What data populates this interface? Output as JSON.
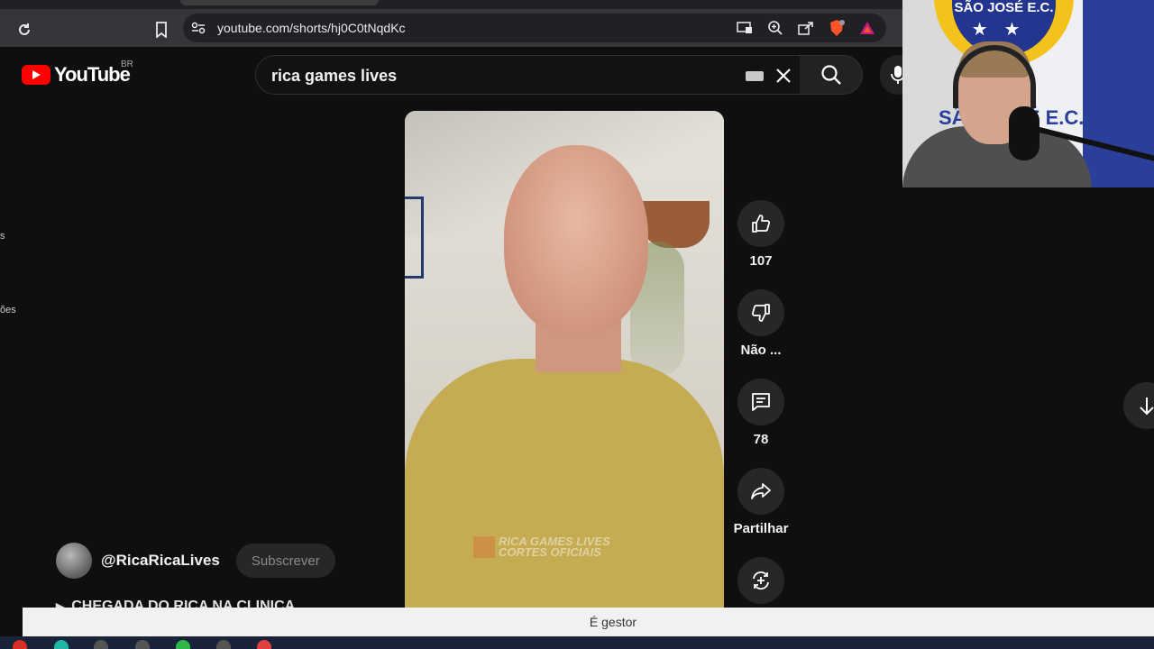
{
  "browser": {
    "url": "youtube.com/shorts/hj0C0tNqdKc"
  },
  "youtube": {
    "logo_text": "YouTube",
    "country_code": "BR",
    "search_query": "rica games lives"
  },
  "sidebar_fragments": [
    "s",
    "ões"
  ],
  "short": {
    "watermark_line1": "RICA GAMES LIVES",
    "watermark_line2": "CORTES OFICIAIS",
    "actions": {
      "like_count": "107",
      "dislike_label": "Não ...",
      "comments_count": "78",
      "share_label": "Partilhar"
    },
    "channel_name": "@RicaRicaLives",
    "subscribe_label": "Subscrever",
    "title": "CHEGADA DO RICA NA CLINICA"
  },
  "webcam": {
    "badge_text": "SÃO JOSÉ E.C.",
    "banner_text": "SÃO JOSÉ E.C."
  },
  "bottom_bar": {
    "text": "É gestor"
  },
  "colors": {
    "youtube_red": "#ff0000",
    "background": "#0f0f0f",
    "action_circle": "#272727"
  }
}
